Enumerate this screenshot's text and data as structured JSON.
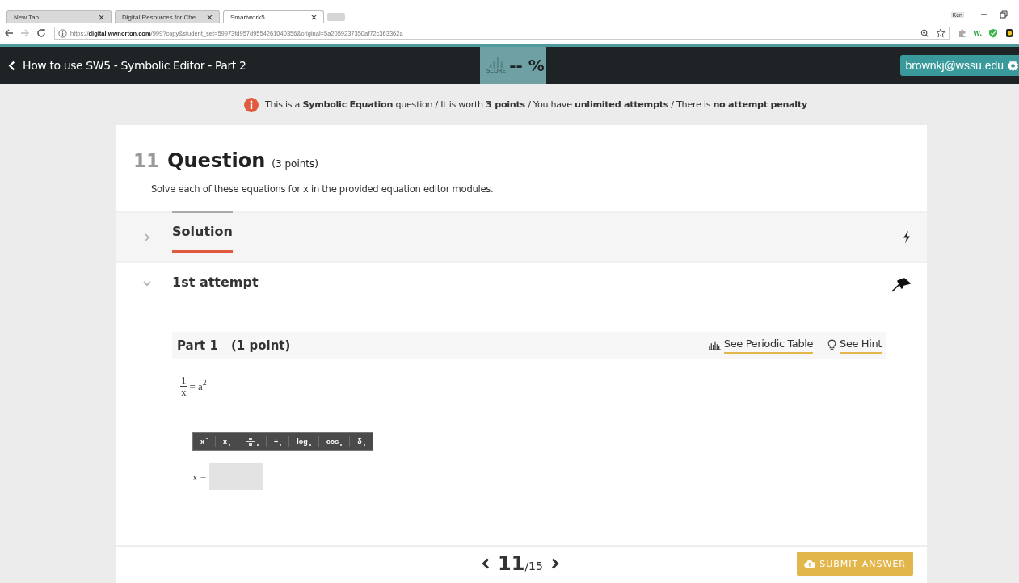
{
  "browser": {
    "tabs": [
      {
        "label": "New Tab",
        "selected": false
      },
      {
        "label": "Digital Resources for Che",
        "selected": false
      },
      {
        "label": "Smartwork5",
        "selected": true
      }
    ],
    "profile": "Ken",
    "url": {
      "scheme": "https://",
      "host": "digital.wwnorton.com",
      "rest": "/999?copy&student_set=59973fd957d9554261040356&original=5a2059237350af72c363362a"
    },
    "extension_text": "W."
  },
  "header": {
    "title": "How to use SW5 - Symbolic Editor - Part 2",
    "score": "-- %",
    "score_label": "SCORE",
    "user": "brownkj@wssu.edu"
  },
  "info": "This is a **Symbolic Equation** question / It is worth **3 points** / You have **unlimited attempts** / There is **no attempt penalty**",
  "question": {
    "number": "11",
    "title": "Question",
    "points": "(3 points)",
    "instruction": "Solve each of these equations for x in the provided equation editor modules."
  },
  "sections": [
    {
      "kind": "solution",
      "title": "Solution",
      "expanded": false,
      "selected": true
    },
    {
      "kind": "attempt",
      "title": "1st attempt",
      "expanded": true,
      "selected": false
    }
  ],
  "part": {
    "title": "Part 1",
    "points": "(1 point)",
    "links": [
      {
        "kind": "periodic",
        "label": "See Periodic Table"
      },
      {
        "kind": "hint",
        "label": "See Hint"
      }
    ],
    "equation": {
      "numerator": "1",
      "denominator": "x",
      "rhs": "= a",
      "exponent": "2"
    },
    "toolbar": [
      {
        "kind": "sup",
        "label": "x"
      },
      {
        "kind": "sub",
        "label": "x"
      },
      {
        "kind": "frac"
      },
      {
        "kind": "text",
        "label": "+"
      },
      {
        "kind": "text",
        "label": "log"
      },
      {
        "kind": "text",
        "label": "cos"
      },
      {
        "kind": "text",
        "label": "δ"
      }
    ],
    "answer_label": "x ="
  },
  "pager": {
    "current": "11",
    "total": "/15"
  },
  "submit": "SUBMIT ANSWER"
}
